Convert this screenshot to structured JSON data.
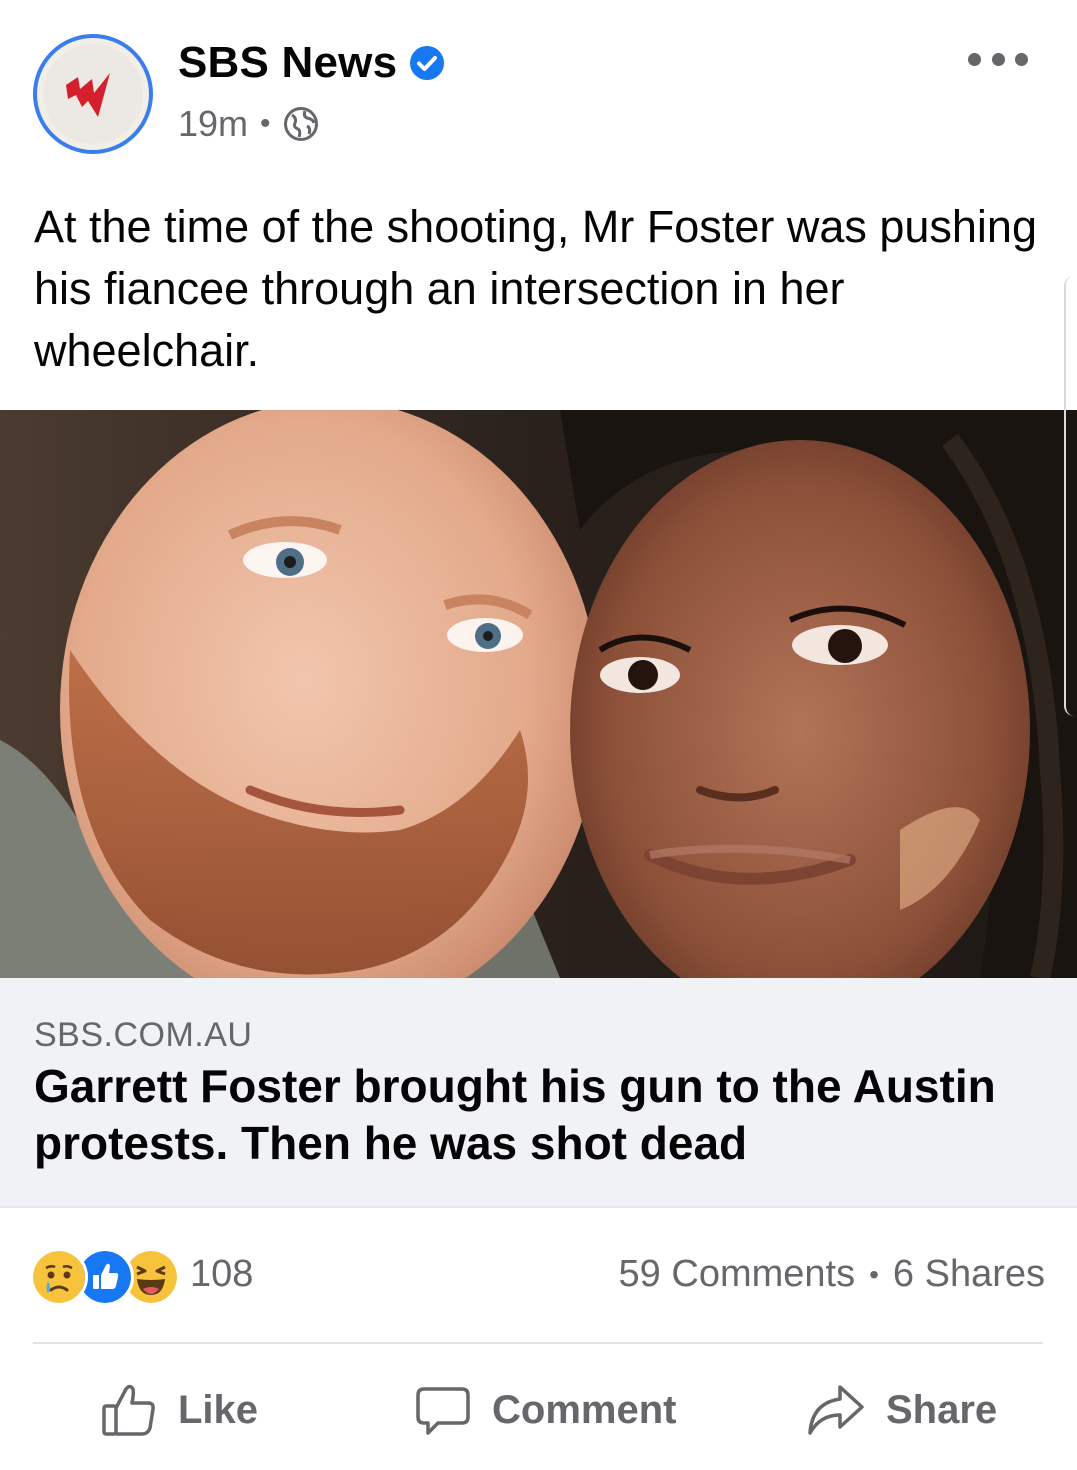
{
  "post": {
    "page_name": "SBS News",
    "verified": true,
    "time": "19m",
    "audience_icon": "globe-icon",
    "more_icon": "more-options-icon",
    "text": "At the time of the shooting, Mr Foster was pushing his fiancee through an intersection in her wheelchair.",
    "image": "photo of Garrett Foster and his fiancee",
    "link": {
      "domain": "SBS.COM.AU",
      "title": "Garrett Foster brought his gun to the Austin protests. Then he was shot dead"
    },
    "reactions": {
      "icons": [
        "sad-reaction-icon",
        "like-reaction-icon",
        "haha-reaction-icon"
      ],
      "count": "108"
    },
    "comments": "59 Comments",
    "shares": "6 Shares",
    "separator": "•",
    "actions": {
      "like": "Like",
      "comment": "Comment",
      "share": "Share"
    }
  },
  "colors": {
    "brand_blue": "#1877f2",
    "secondary_text": "#65676b",
    "link_background": "#f0f2f5",
    "sbs_red": "#d4202c"
  }
}
